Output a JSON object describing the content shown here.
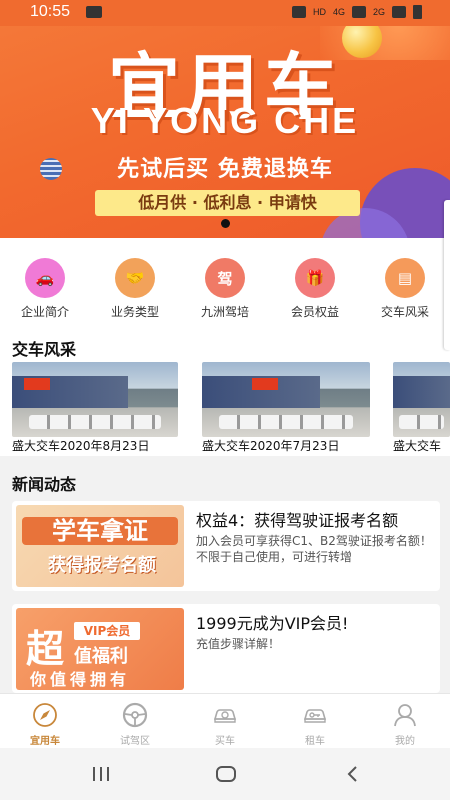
{
  "status_bar": {
    "time": "10:55",
    "indicators": [
      "HD",
      "4G",
      "2G"
    ]
  },
  "banner": {
    "title": "宜用车",
    "subtitle": "YI YONG CHE",
    "slogan": "先试后买 免费退换车",
    "pill": "低月供 · 低利息 · 申请快"
  },
  "categories": [
    {
      "label": "企业简介",
      "icon": "car-icon",
      "color": "#f07ad6",
      "glyph": "🚗"
    },
    {
      "label": "业务类型",
      "icon": "handshake-icon",
      "color": "#f2a25a",
      "glyph": "🤝"
    },
    {
      "label": "九洲驾培",
      "icon": "driving-school-icon",
      "color": "#f07a66",
      "glyph": "驾"
    },
    {
      "label": "会员权益",
      "icon": "gift-icon",
      "color": "#f27a7a",
      "glyph": "🎁"
    },
    {
      "label": "交车风采",
      "icon": "license-card-icon",
      "color": "#f59a5a",
      "glyph": "▤"
    }
  ],
  "delivery": {
    "title": "交车风采",
    "items": [
      {
        "caption": "盛大交车2020年8月23日"
      },
      {
        "caption": "盛大交车2020年7月23日"
      },
      {
        "caption": "盛大交车"
      }
    ]
  },
  "news": {
    "title": "新闻动态",
    "items": [
      {
        "title": "权益4：获得驾驶证报考名额",
        "desc": "加入会员可享获得C1、B2驾驶证报考名额！不限于自己使用，可进行转增",
        "thumb_line1": "学车拿证",
        "thumb_line2": "获得报考名额"
      },
      {
        "title": "1999元成为VIP会员!",
        "desc": "充值步骤详解！",
        "thumb_big": "超",
        "thumb_vip": "VIP会员",
        "thumb_benefit": "值福利",
        "thumb_own": "你值得拥有"
      }
    ]
  },
  "tabs": [
    {
      "label": "宜用车",
      "icon": "compass-icon",
      "active": true
    },
    {
      "label": "试驾区",
      "icon": "steering-wheel-icon",
      "active": false
    },
    {
      "label": "买车",
      "icon": "buy-car-icon",
      "active": false
    },
    {
      "label": "租车",
      "icon": "rent-car-icon",
      "active": false
    },
    {
      "label": "我的",
      "icon": "user-icon",
      "active": false
    }
  ],
  "colors": {
    "accent": "#f06b2f",
    "tab_active": "#c8873a",
    "tab_inactive": "#aaaaaa"
  }
}
